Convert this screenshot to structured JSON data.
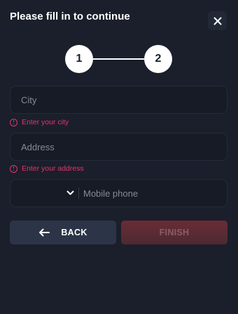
{
  "header": {
    "title": "Please fill in to continue"
  },
  "steps": [
    {
      "number": "1"
    },
    {
      "number": "2"
    }
  ],
  "form": {
    "city": {
      "placeholder": "City",
      "value": "",
      "error": "Enter your city"
    },
    "address": {
      "placeholder": "Address",
      "value": "",
      "error": "Enter your address"
    },
    "phone": {
      "placeholder": "Mobile phone",
      "value": "",
      "country_code": ""
    }
  },
  "actions": {
    "back_label": "BACK",
    "finish_label": "FINISH"
  },
  "colors": {
    "background": "#1a1f2b",
    "error": "#e8336a",
    "back_button": "#2c3447",
    "finish_button": "#6a2c34"
  }
}
